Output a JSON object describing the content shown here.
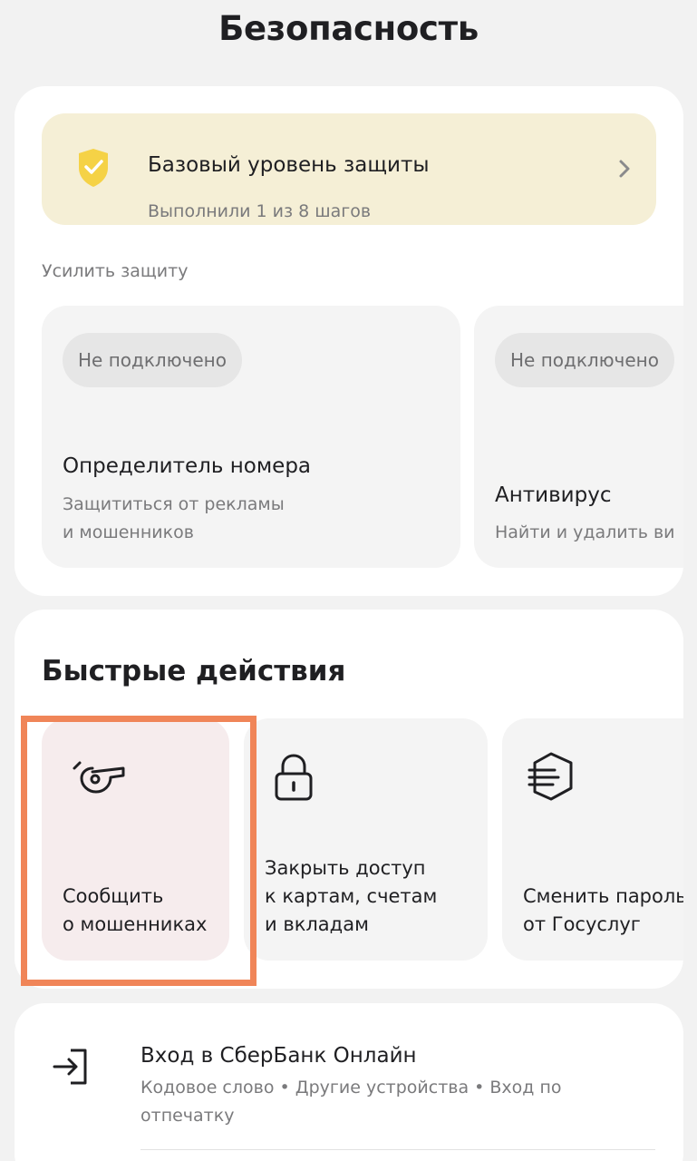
{
  "page_title": "Безопасность",
  "protection_banner": {
    "title": "Базовый уровень защиты",
    "subtitle": "Выполнили 1 из 8 шагов",
    "icon": "shield-check-icon",
    "accent_color": "#f5d246",
    "background_color": "#f5efd6"
  },
  "strengthen": {
    "label": "Усилить защиту",
    "items": [
      {
        "status": "Не подключено",
        "title": "Определитель номера",
        "description": "Защититься от рекламы\nи мошенников"
      },
      {
        "status": "Не подключено",
        "title": "Антивирус",
        "description": "Найти и удалить ви"
      }
    ]
  },
  "quick_actions": {
    "title": "Быстрые действия",
    "items": [
      {
        "label": "Сообщить\nо мошенниках",
        "icon": "whistle-icon"
      },
      {
        "label": "Закрыть доступ\nк картам, счетам\nи вкладам",
        "icon": "lock-icon"
      },
      {
        "label": "Сменить пароль\nот Госуслуг",
        "icon": "gosuslugi-icon"
      }
    ]
  },
  "login_section": {
    "title": "Вход в СберБанк Онлайн",
    "description": "Кодовое слово • Другие устройства • Вход по отпечатку",
    "icon": "sign-in-icon"
  },
  "highlight_color": "#f08558"
}
